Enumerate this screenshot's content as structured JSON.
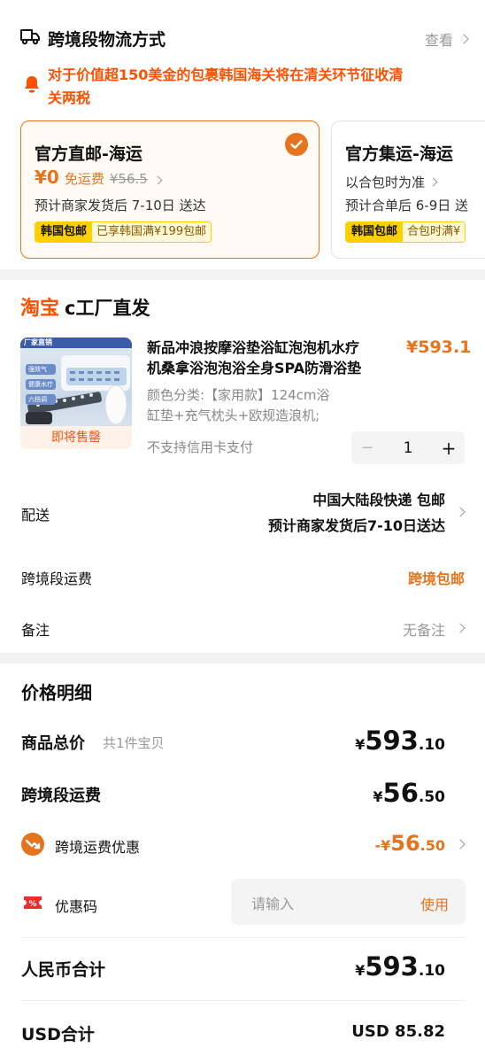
{
  "shipping_section": {
    "title": "跨境段物流方式",
    "view_label": "查看",
    "notice": "对于价值超150美金的包裹韩国海关将在清关环节征收清关两税",
    "notice_line1": "对于价值超150美金的包裹韩国海关将在清关环节征收清",
    "notice_line2": "关两税",
    "options": [
      {
        "title": "官方直邮-海运",
        "price": "¥0",
        "free_label": "免运费",
        "original_price": "¥56.5",
        "eta": "预计商家发货后 7-10日 送达",
        "tag": "韩国包邮",
        "tag_desc": "已享韩国满¥199包邮",
        "selected": true
      },
      {
        "title": "官方集运-海运",
        "sub": "以合包时为准",
        "eta": "预计合单后 6-9日 送",
        "tag": "韩国包邮",
        "tag_desc": "合包时满¥",
        "selected": false
      }
    ]
  },
  "store": {
    "brand": "淘宝",
    "name": "c工厂直发"
  },
  "product": {
    "thumb_top": "厂家直销",
    "thumb_labels": [
      "强效气",
      "健康水疗",
      "六档调"
    ],
    "thumb_badge": "即将售罄",
    "title_line1": "新品冲浪按摩浴垫浴缸泡泡机水疗",
    "title_line2": "机桑拿浴泡泡浴全身SPA防滑浴垫",
    "price": "¥593.1",
    "variant_line1": "颜色分类:【家用款】124cm浴",
    "variant_line2": "缸垫+充气枕头+欧规造浪机;",
    "payment_note": "不支持信用卡支付",
    "quantity": "1",
    "minus": "−",
    "plus": "+"
  },
  "delivery": {
    "label": "配送",
    "line1": "中国大陆段快递 包邮",
    "line2": "预计商家发货后7-10日送达"
  },
  "crossborder_fee": {
    "label": "跨境段运费",
    "value": "跨境包邮"
  },
  "remark": {
    "label": "备注",
    "value": "无备注"
  },
  "price_detail": {
    "title": "价格明细",
    "goods_total_label": "商品总价",
    "goods_count": "共1件宝贝",
    "goods_total_int": "593",
    "goods_total_dec": ".10",
    "shipping_label": "跨境段运费",
    "shipping_int": "56",
    "shipping_dec": ".50",
    "discount_label": "跨境运费优惠",
    "discount_prefix": "-¥",
    "discount_int": "56",
    "discount_dec": ".50",
    "coupon_label": "优惠码",
    "coupon_placeholder": "请输入",
    "coupon_apply": "使用",
    "rmb_total_label": "人民币合计",
    "rmb_total_int": "593",
    "rmb_total_dec": ".10",
    "usd_total_label": "USD合计",
    "usd_total_value": "USD 85.82",
    "currency": "¥"
  },
  "colors": {
    "orange": "#ff5000",
    "amber": "#e6731e",
    "tag_yellow": "#ffd000"
  }
}
